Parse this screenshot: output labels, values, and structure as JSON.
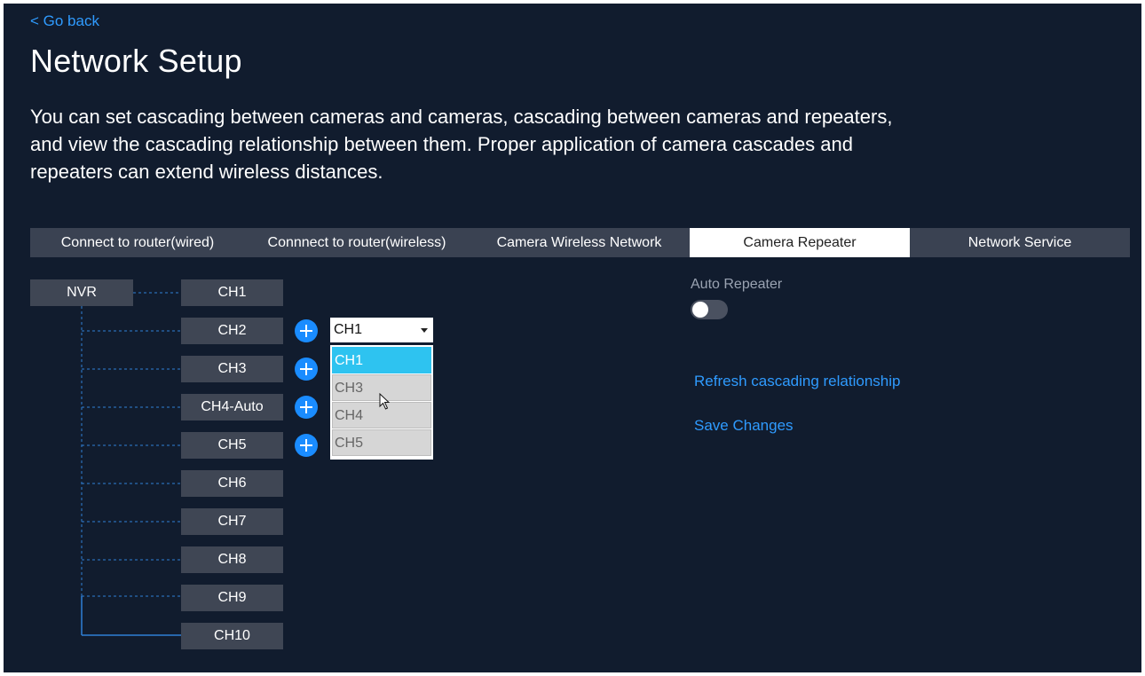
{
  "nav": {
    "go_back": "< Go back"
  },
  "page": {
    "title": "Network Setup",
    "description": "You can set cascading between cameras and cameras, cascading between cameras and repeaters, and view the cascading relationship between them. Proper application of camera cascades and repeaters can extend wireless distances."
  },
  "tabs": [
    {
      "label": "Connect to router(wired)",
      "active": false
    },
    {
      "label": "Connnect to router(wireless)",
      "active": false
    },
    {
      "label": "Camera Wireless Network",
      "active": false
    },
    {
      "label": "Camera Repeater",
      "active": true
    },
    {
      "label": "Network Service",
      "active": false
    }
  ],
  "tree": {
    "root": "NVR",
    "channels": [
      "CH1",
      "CH2",
      "CH3",
      "CH4-Auto",
      "CH5",
      "CH6",
      "CH7",
      "CH8",
      "CH9",
      "CH10"
    ]
  },
  "select": {
    "value": "CH1",
    "options": [
      {
        "label": "CH1",
        "selected": true
      },
      {
        "label": "CH3",
        "selected": false
      },
      {
        "label": "CH4",
        "selected": false
      },
      {
        "label": "CH5",
        "selected": false
      }
    ]
  },
  "right_panel": {
    "auto_repeater_label": "Auto Repeater",
    "auto_repeater_on": false,
    "refresh_link": "Refresh cascading relationship",
    "save_link": "Save Changes"
  },
  "colors": {
    "background": "#111c2e",
    "node_bg": "#3f4654",
    "accent": "#2f9bff",
    "selected_option": "#2ec3f0",
    "add_button": "#1a8cff"
  }
}
